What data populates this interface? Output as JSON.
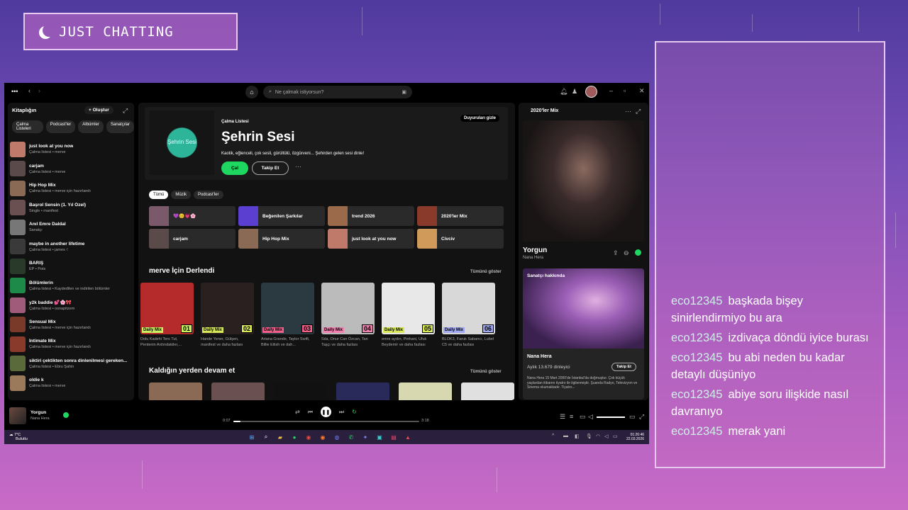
{
  "overlay": {
    "title": "JUST CHATTING"
  },
  "chat": {
    "messages": [
      {
        "user": "eco12345",
        "text": "başkada bişey sinirlendirmiyo bu ara"
      },
      {
        "user": "eco12345",
        "text": "izdivaça döndü iyice burası"
      },
      {
        "user": "eco12345",
        "text": "bu abi neden bu kadar detaylı düşüniyo"
      },
      {
        "user": "eco12345",
        "text": "abiye soru ilişkide nasıl davranıyo"
      },
      {
        "user": "eco12345",
        "text": "merak yani"
      }
    ]
  },
  "spotify": {
    "search_placeholder": "Ne çalmak istiyorsun?",
    "library": {
      "title": "Kitaplığın",
      "create_label": "Oluştur",
      "chips": [
        "Çalma Listeleri",
        "Podcast'ler",
        "Albümler",
        "Sanatçılar"
      ],
      "items": [
        {
          "name": "just look at you now",
          "sub": "Çalma listesi • merve",
          "color": "#c07a6a"
        },
        {
          "name": "carjam",
          "sub": "Çalma listesi • merve",
          "color": "#5a4a4a"
        },
        {
          "name": "Hip Hop Mix",
          "sub": "Çalma listesi • merve için hazırlandı",
          "color": "#8a6a55"
        },
        {
          "name": "Başrol Sensin (1. Yıl Özel)",
          "sub": "Single • manifest",
          "color": "#6a5050"
        },
        {
          "name": "Anıl Emre Daldal",
          "sub": "Sanatçı",
          "color": "#777777"
        },
        {
          "name": "maybe in another lifetime",
          "sub": "Çalma listesi • james ☾",
          "color": "#3a3a3a"
        },
        {
          "name": "BARIŞ",
          "sub": "EP • Pots",
          "color": "#2a3a2a"
        },
        {
          "name": "Bölümlerin",
          "sub": "Çalma listesi • Kaydedilen ve indirilen bölümler",
          "color": "#1e8a4a"
        },
        {
          "name": "y2k baddie 💕🌸🎀",
          "sub": "Çalma listesi • osnapitzem",
          "color": "#a05a7a"
        },
        {
          "name": "Sensual Mix",
          "sub": "Çalma listesi • merve için hazırlandı",
          "color": "#7a3a2a"
        },
        {
          "name": "İntimate Mix",
          "sub": "Çalma listesi • merve için hazırlandı",
          "color": "#8a3a2a"
        },
        {
          "name": "siktiri çektikten sonra dinlenilmesi gereken...",
          "sub": "Çalma listesi • Ebru Şahin",
          "color": "#5a6a3a"
        },
        {
          "name": "oldie k",
          "sub": "Çalma listesi • merve",
          "color": "#9a7a5a"
        }
      ]
    },
    "hero": {
      "type": "Çalma Listesi",
      "title": "Şehrin Sesi",
      "image_text": "Şehrin Sesi",
      "desc": "Kaotik, eğlenceli, çok sesli, gürültülü, özgürveni... Şehirden gelen sesi dinle!",
      "play": "Çal",
      "follow": "Takip Et",
      "more": "···",
      "hide": "Duyuruları gizle"
    },
    "filters": [
      "Tümü",
      "Müzik",
      "Podcast'ler"
    ],
    "grid": [
      {
        "name": "💜😊💗🌸",
        "color": "#7a5a6a"
      },
      {
        "name": "Beğenilen Şarkılar",
        "color": "#5a3fd0"
      },
      {
        "name": "trend 2026",
        "color": "#9a6a4a"
      },
      {
        "name": "2020'ler Mix",
        "color": "#8a3a2a"
      },
      {
        "name": "carjam",
        "color": "#5a4a4a"
      },
      {
        "name": "Hip Hop Mix",
        "color": "#8a6a55"
      },
      {
        "name": "just look at you now",
        "color": "#c07a6a"
      },
      {
        "name": "Civciv",
        "color": "#d09a5a"
      }
    ],
    "section1": {
      "title": "merve İçin Derlendi",
      "more": "Tümünü göster"
    },
    "cards": [
      {
        "tag": "Daily Mix",
        "num": "01",
        "color": "#b52a2a",
        "tagc": "#c8f060",
        "desc": "Dolu Kadehi Ters Tut, Pentenin Ardındakiler,..."
      },
      {
        "tag": "Daily Mix",
        "num": "02",
        "color": "#2a2020",
        "tagc": "#d8e858",
        "desc": "Hande Yener, Gülşen, manifest ve daha fazlası"
      },
      {
        "tag": "Daily Mix",
        "num": "03",
        "color": "#2a3a40",
        "tagc": "#f0608a",
        "desc": "Ariana Grande, Taylor Swift, Billie Eilish ve dah..."
      },
      {
        "tag": "Daily Mix",
        "num": "04",
        "color": "#bbbbbb",
        "tagc": "#f080b0",
        "desc": "Sıla, Onur Can Özcan, Tan Taşçı ve daha fazlası"
      },
      {
        "tag": "Daily Mix",
        "num": "05",
        "color": "#e8e8e8",
        "tagc": "#d8e858",
        "desc": "emre aydın, Pinhani, Ufuk Beydemir ve daha fazlası"
      },
      {
        "tag": "Daily Mix",
        "num": "06",
        "color": "#d8d8d8",
        "tagc": "#a0a8f0",
        "desc": "BLOK3, Faruk Sabancı, Lubel C5 ve daha fazlası"
      }
    ],
    "section2": {
      "title": "Kaldığın yerden devam et",
      "more": "Tümünü göster"
    },
    "cards2": [
      "#8a6a55",
      "#6a5050",
      "#111111",
      "#2a2a5a",
      "#d8d8b0",
      "#e0e0e0"
    ],
    "right": {
      "title": "2020'ler Mix",
      "song": "Yorgun",
      "artist": "Nana Hera",
      "about_label": "Sanatçı hakkında",
      "about_name": "Nana Hera",
      "listeners": "Aylık 13.679 dinleyici",
      "follow": "Takip Et",
      "bio": "Nana Hera 15 Mart 2000'de İstanbul'da doğmuştur. Çok küçük yaşlardan itibaren tiyatro ile ilgilenmiştir. Şuanda Radyo, Televizyon ve Sinema okumaktadır. Tiyatro..."
    },
    "player": {
      "title": "Yorgun",
      "artist": "Nana Hera",
      "current": "0:07",
      "total": "3:18",
      "progress": 0.04
    },
    "taskbar": {
      "temp": "7°C",
      "weather": "Bulutlu",
      "time": "01:26:46",
      "date": "22.03.2026"
    }
  }
}
